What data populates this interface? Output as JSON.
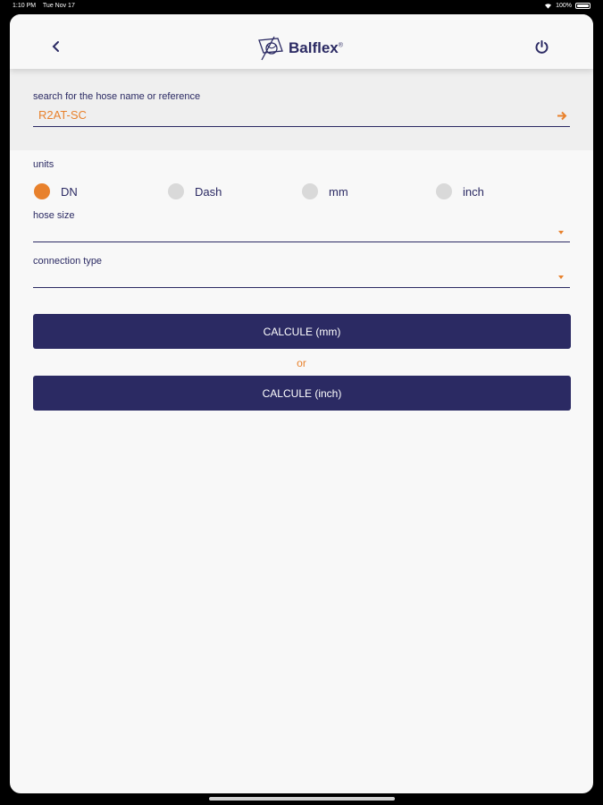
{
  "status": {
    "time": "1:10 PM",
    "date": "Tue Nov 17",
    "battery": "100%"
  },
  "header": {
    "brand": "Balflex",
    "registered": "®"
  },
  "search": {
    "label": "search for the hose name or reference",
    "value": "R2AT-SC"
  },
  "units": {
    "label": "units",
    "options": [
      {
        "label": "DN",
        "selected": true
      },
      {
        "label": "Dash",
        "selected": false
      },
      {
        "label": "mm",
        "selected": false
      },
      {
        "label": "inch",
        "selected": false
      }
    ]
  },
  "hose_size": {
    "label": "hose size",
    "value": ""
  },
  "connection_type": {
    "label": "connection type",
    "value": ""
  },
  "buttons": {
    "calc_mm": "CALCULE (mm)",
    "or": "or",
    "calc_inch": "CALCULE (inch)"
  },
  "colors": {
    "brand": "#2b2a63",
    "accent": "#e8812c",
    "background": "#f8f8f8"
  }
}
